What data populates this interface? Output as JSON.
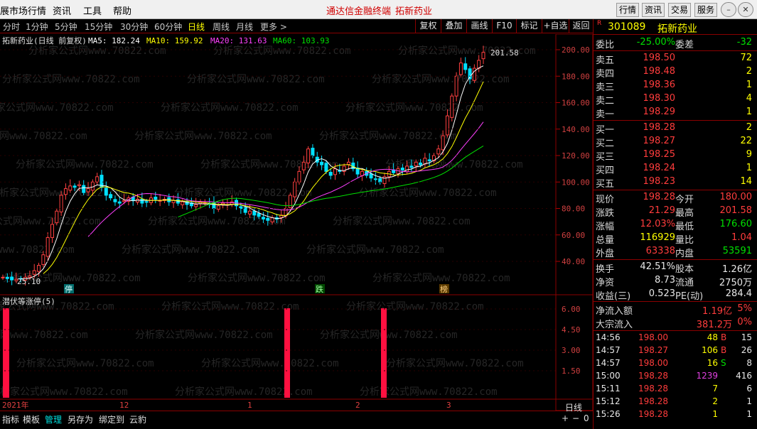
{
  "menu": {
    "items": [
      "展市场行情",
      "资讯",
      "工具",
      "帮助"
    ],
    "center": [
      "通达信金融终端",
      "拓新药业"
    ],
    "right_buttons": [
      "行情",
      "资讯",
      "交易",
      "服务"
    ]
  },
  "periods": [
    "分时",
    "1分钟",
    "5分钟",
    "15分钟",
    "30分钟",
    "60分钟",
    "日线",
    "周线",
    "月线",
    "更多 >"
  ],
  "active_period": "日线",
  "toolbar": [
    "复权",
    "叠加",
    "画线",
    "F10",
    "标记",
    "+自选",
    "返回"
  ],
  "chart_header": {
    "title": "拓新药业(日线 前复权)",
    "ma5": "MA5: 182.24",
    "ma10": "MA10: 159.92",
    "ma20": "MA20: 131.63",
    "ma60": "MA60: 103.93",
    "colors": {
      "ma5": "#ffffff",
      "ma10": "#ffff00",
      "ma20": "#ff40ff",
      "ma60": "#00e000"
    }
  },
  "price_axis": [
    "200.00",
    "180.00",
    "160.00",
    "140.00",
    "120.00",
    "100.00",
    "80.00",
    "60.00",
    "40.00"
  ],
  "annotations": {
    "high": "201.58",
    "low": "25.10",
    "marks": [
      "停",
      "跌",
      "榜"
    ]
  },
  "indicator": {
    "title": "潜伏等涨停(5)",
    "axis": [
      "6.00",
      "4.50",
      "3.00",
      "1.50"
    ]
  },
  "date_labels": [
    "2021年",
    "12",
    "1",
    "2",
    "3"
  ],
  "period_tag": "日线",
  "bottom_tabs": [
    "指标",
    "模板",
    "管理",
    "另存为",
    "绑定到",
    "云豹"
  ],
  "bottom_active": "管理",
  "bottom_controls": [
    "+",
    "−",
    "0"
  ],
  "watermark": "分析家公式网www.70822.com",
  "quote": {
    "code": "301089",
    "name": "拓新药业",
    "badge": "R",
    "weibi": {
      "label": "委比",
      "value": "-25.00%",
      "label2": "委差",
      "value2": "-32"
    },
    "sells": [
      {
        "label": "卖五",
        "price": "198.50",
        "vol": "72"
      },
      {
        "label": "卖四",
        "price": "198.48",
        "vol": "2"
      },
      {
        "label": "卖三",
        "price": "198.36",
        "vol": "1"
      },
      {
        "label": "卖二",
        "price": "198.30",
        "vol": "4"
      },
      {
        "label": "卖一",
        "price": "198.29",
        "vol": "1"
      }
    ],
    "buys": [
      {
        "label": "买一",
        "price": "198.28",
        "vol": "2"
      },
      {
        "label": "买二",
        "price": "198.27",
        "vol": "22"
      },
      {
        "label": "买三",
        "price": "198.25",
        "vol": "9"
      },
      {
        "label": "买四",
        "price": "198.24",
        "vol": "1"
      },
      {
        "label": "买五",
        "price": "198.23",
        "vol": "14"
      }
    ],
    "stats": [
      {
        "l1": "现价",
        "v1": "198.28",
        "c1": "red",
        "l2": "今开",
        "v2": "180.00",
        "c2": "red"
      },
      {
        "l1": "涨跌",
        "v1": "21.29",
        "c1": "red",
        "l2": "最高",
        "v2": "201.58",
        "c2": "red"
      },
      {
        "l1": "涨幅",
        "v1": "12.03%",
        "c1": "red",
        "l2": "最低",
        "v2": "176.60",
        "c2": "green"
      },
      {
        "l1": "总量",
        "v1": "116929",
        "c1": "yellow",
        "l2": "量比",
        "v2": "1.04",
        "c2": "red"
      },
      {
        "l1": "外盘",
        "v1": "63338",
        "c1": "red",
        "l2": "内盘",
        "v2": "53591",
        "c2": "green"
      }
    ],
    "stats2": [
      {
        "l1": "换手",
        "v1": "42.51%",
        "l2": "股本",
        "v2": "1.26亿"
      },
      {
        "l1": "净资",
        "v1": "8.73",
        "l2": "流通",
        "v2": "2750万"
      },
      {
        "l1": "收益(三)",
        "v1": "0.523",
        "l2": "PE(动)",
        "v2": "284.4"
      }
    ],
    "flows": [
      {
        "label": "净流入额",
        "value": "1.19亿",
        "pct": "5%"
      },
      {
        "label": "大宗流入",
        "value": "381.2万",
        "pct": "0%"
      }
    ],
    "ticks": [
      {
        "time": "14:56",
        "price": "198.00",
        "vol": "48",
        "vcolor": "yellow",
        "side": "B",
        "scolor": "red",
        "n": "15"
      },
      {
        "time": "14:57",
        "price": "198.27",
        "vol": "106",
        "vcolor": "yellow",
        "side": "B",
        "scolor": "red",
        "n": "26"
      },
      {
        "time": "14:57",
        "price": "198.00",
        "vol": "16",
        "vcolor": "yellow",
        "side": "S",
        "scolor": "green",
        "n": "8"
      },
      {
        "time": "15:00",
        "price": "198.28",
        "vol": "1239",
        "vcolor": "magenta",
        "side": "",
        "scolor": "white",
        "n": "416"
      },
      {
        "time": "15:11",
        "price": "198.28",
        "vol": "7",
        "vcolor": "yellow",
        "side": "",
        "scolor": "white",
        "n": "6"
      },
      {
        "time": "15:12",
        "price": "198.28",
        "vol": "2",
        "vcolor": "yellow",
        "side": "",
        "scolor": "white",
        "n": "1"
      },
      {
        "time": "15:26",
        "price": "198.28",
        "vol": "1",
        "vcolor": "yellow",
        "side": "",
        "scolor": "white",
        "n": "1"
      }
    ]
  }
}
